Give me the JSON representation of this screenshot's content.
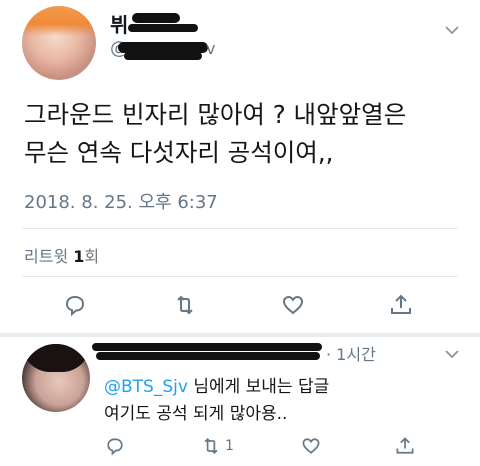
{
  "tweet": {
    "text_line1": "그라운드 빈자리 많아여 ? 내앞앞열은",
    "text_line2": "무슨 연속 다섯자리 공석이여,,",
    "timestamp": "2018. 8. 25. 오후 6:37",
    "retweet_label": "리트윗",
    "retweet_count": "1",
    "retweet_suffix": "회",
    "name_visible_fragment": "뷔",
    "handle_visible_prefix": "@",
    "handle_visible_suffix": "v"
  },
  "reply": {
    "time": "· 1시간",
    "reply_to_mention": "@BTS_Sjv",
    "reply_to_suffix": " 님에게 보내는 답글",
    "text": "여기도 공석 되게 많아용..",
    "retweet_count": "1"
  },
  "colors": {
    "accent": "#1da1f2",
    "muted": "#657786",
    "text": "#14171a",
    "divider": "#e1e8ed"
  }
}
